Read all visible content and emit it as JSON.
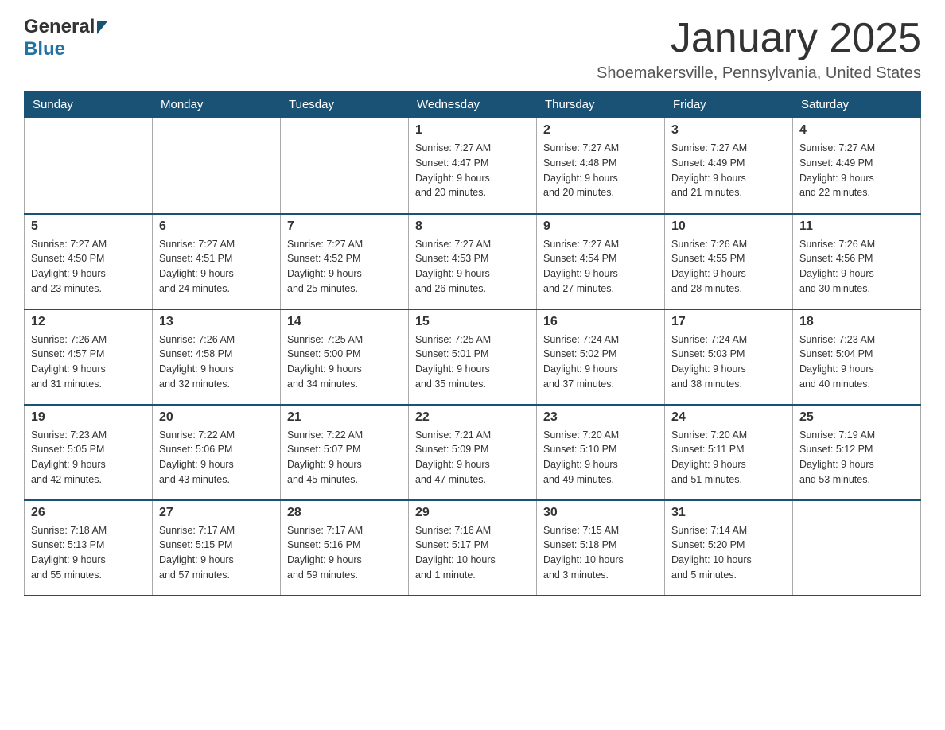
{
  "header": {
    "logo": {
      "general": "General",
      "blue": "Blue"
    },
    "title": "January 2025",
    "location": "Shoemakersville, Pennsylvania, United States"
  },
  "days_of_week": [
    "Sunday",
    "Monday",
    "Tuesday",
    "Wednesday",
    "Thursday",
    "Friday",
    "Saturday"
  ],
  "weeks": [
    [
      {
        "day": "",
        "info": ""
      },
      {
        "day": "",
        "info": ""
      },
      {
        "day": "",
        "info": ""
      },
      {
        "day": "1",
        "info": "Sunrise: 7:27 AM\nSunset: 4:47 PM\nDaylight: 9 hours\nand 20 minutes."
      },
      {
        "day": "2",
        "info": "Sunrise: 7:27 AM\nSunset: 4:48 PM\nDaylight: 9 hours\nand 20 minutes."
      },
      {
        "day": "3",
        "info": "Sunrise: 7:27 AM\nSunset: 4:49 PM\nDaylight: 9 hours\nand 21 minutes."
      },
      {
        "day": "4",
        "info": "Sunrise: 7:27 AM\nSunset: 4:49 PM\nDaylight: 9 hours\nand 22 minutes."
      }
    ],
    [
      {
        "day": "5",
        "info": "Sunrise: 7:27 AM\nSunset: 4:50 PM\nDaylight: 9 hours\nand 23 minutes."
      },
      {
        "day": "6",
        "info": "Sunrise: 7:27 AM\nSunset: 4:51 PM\nDaylight: 9 hours\nand 24 minutes."
      },
      {
        "day": "7",
        "info": "Sunrise: 7:27 AM\nSunset: 4:52 PM\nDaylight: 9 hours\nand 25 minutes."
      },
      {
        "day": "8",
        "info": "Sunrise: 7:27 AM\nSunset: 4:53 PM\nDaylight: 9 hours\nand 26 minutes."
      },
      {
        "day": "9",
        "info": "Sunrise: 7:27 AM\nSunset: 4:54 PM\nDaylight: 9 hours\nand 27 minutes."
      },
      {
        "day": "10",
        "info": "Sunrise: 7:26 AM\nSunset: 4:55 PM\nDaylight: 9 hours\nand 28 minutes."
      },
      {
        "day": "11",
        "info": "Sunrise: 7:26 AM\nSunset: 4:56 PM\nDaylight: 9 hours\nand 30 minutes."
      }
    ],
    [
      {
        "day": "12",
        "info": "Sunrise: 7:26 AM\nSunset: 4:57 PM\nDaylight: 9 hours\nand 31 minutes."
      },
      {
        "day": "13",
        "info": "Sunrise: 7:26 AM\nSunset: 4:58 PM\nDaylight: 9 hours\nand 32 minutes."
      },
      {
        "day": "14",
        "info": "Sunrise: 7:25 AM\nSunset: 5:00 PM\nDaylight: 9 hours\nand 34 minutes."
      },
      {
        "day": "15",
        "info": "Sunrise: 7:25 AM\nSunset: 5:01 PM\nDaylight: 9 hours\nand 35 minutes."
      },
      {
        "day": "16",
        "info": "Sunrise: 7:24 AM\nSunset: 5:02 PM\nDaylight: 9 hours\nand 37 minutes."
      },
      {
        "day": "17",
        "info": "Sunrise: 7:24 AM\nSunset: 5:03 PM\nDaylight: 9 hours\nand 38 minutes."
      },
      {
        "day": "18",
        "info": "Sunrise: 7:23 AM\nSunset: 5:04 PM\nDaylight: 9 hours\nand 40 minutes."
      }
    ],
    [
      {
        "day": "19",
        "info": "Sunrise: 7:23 AM\nSunset: 5:05 PM\nDaylight: 9 hours\nand 42 minutes."
      },
      {
        "day": "20",
        "info": "Sunrise: 7:22 AM\nSunset: 5:06 PM\nDaylight: 9 hours\nand 43 minutes."
      },
      {
        "day": "21",
        "info": "Sunrise: 7:22 AM\nSunset: 5:07 PM\nDaylight: 9 hours\nand 45 minutes."
      },
      {
        "day": "22",
        "info": "Sunrise: 7:21 AM\nSunset: 5:09 PM\nDaylight: 9 hours\nand 47 minutes."
      },
      {
        "day": "23",
        "info": "Sunrise: 7:20 AM\nSunset: 5:10 PM\nDaylight: 9 hours\nand 49 minutes."
      },
      {
        "day": "24",
        "info": "Sunrise: 7:20 AM\nSunset: 5:11 PM\nDaylight: 9 hours\nand 51 minutes."
      },
      {
        "day": "25",
        "info": "Sunrise: 7:19 AM\nSunset: 5:12 PM\nDaylight: 9 hours\nand 53 minutes."
      }
    ],
    [
      {
        "day": "26",
        "info": "Sunrise: 7:18 AM\nSunset: 5:13 PM\nDaylight: 9 hours\nand 55 minutes."
      },
      {
        "day": "27",
        "info": "Sunrise: 7:17 AM\nSunset: 5:15 PM\nDaylight: 9 hours\nand 57 minutes."
      },
      {
        "day": "28",
        "info": "Sunrise: 7:17 AM\nSunset: 5:16 PM\nDaylight: 9 hours\nand 59 minutes."
      },
      {
        "day": "29",
        "info": "Sunrise: 7:16 AM\nSunset: 5:17 PM\nDaylight: 10 hours\nand 1 minute."
      },
      {
        "day": "30",
        "info": "Sunrise: 7:15 AM\nSunset: 5:18 PM\nDaylight: 10 hours\nand 3 minutes."
      },
      {
        "day": "31",
        "info": "Sunrise: 7:14 AM\nSunset: 5:20 PM\nDaylight: 10 hours\nand 5 minutes."
      },
      {
        "day": "",
        "info": ""
      }
    ]
  ]
}
